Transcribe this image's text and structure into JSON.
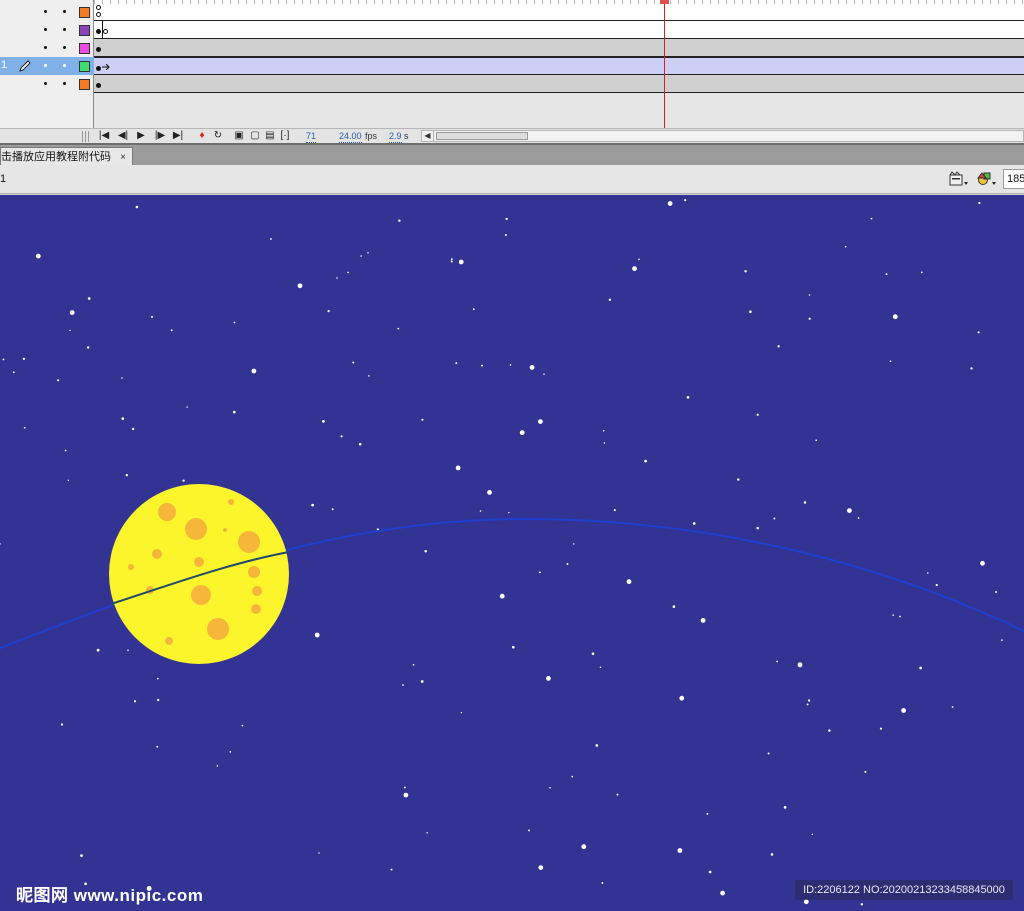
{
  "timeline": {
    "layers": [
      {
        "num": "",
        "color": "#f07a22",
        "selected": false
      },
      {
        "num": "",
        "color": "#8a43b8",
        "selected": false
      },
      {
        "num": "",
        "color": "#e84de0",
        "selected": false
      },
      {
        "num": "1",
        "color": "#3fdc73",
        "selected": true
      },
      {
        "num": "",
        "color": "#f07a22",
        "selected": false
      }
    ],
    "current_frame": "71",
    "fps_value": "24.00",
    "fps_unit": "fps",
    "elapsed_value": "2.9",
    "elapsed_unit": "s"
  },
  "doc_tab": {
    "title": "击播放应用教程附代码",
    "close_glyph": "×"
  },
  "edit_bar": {
    "scene_label": "1",
    "zoom_value": "185"
  },
  "stage": {
    "background": "#333393",
    "moon_color": "#fdf52c",
    "crater_color": "#f5b63a",
    "orbit_color": "#1f3fcf"
  },
  "watermark": {
    "site": "昵图网 www.nipic.com",
    "id_text": "ID:2206122 NO:20200213233458845000"
  }
}
